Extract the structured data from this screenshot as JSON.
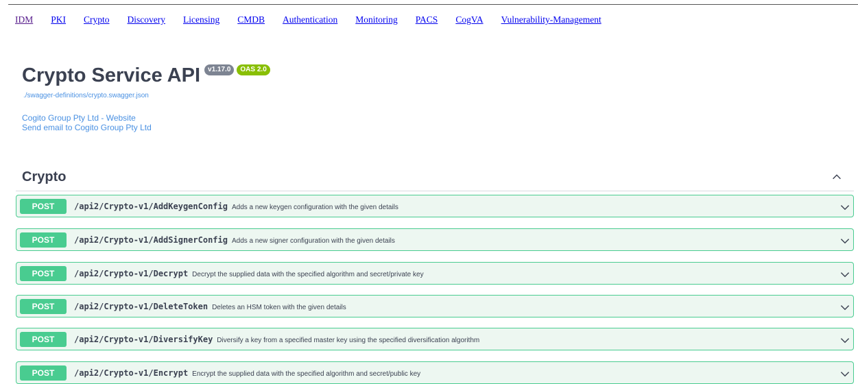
{
  "nav": [
    "IDM",
    "PKI",
    "Crypto",
    "Discovery",
    "Licensing",
    "CMDB",
    "Authentication",
    "Monitoring",
    "PACS",
    "CogVA",
    "Vulnerability-Management"
  ],
  "header": {
    "title": "Crypto Service API",
    "version_badge": "v1.17.0",
    "oas_badge": "OAS 2.0",
    "spec_link": "./swagger-definitions/crypto.swagger.json",
    "website_link": "Cogito Group Pty Ltd - Website",
    "email_link": "Send email to Cogito Group Pty Ltd"
  },
  "section": {
    "title": "Crypto"
  },
  "operations": [
    {
      "method": "POST",
      "path": "/api2/Crypto-v1/AddKeygenConfig",
      "desc": "Adds a new keygen configuration with the given details"
    },
    {
      "method": "POST",
      "path": "/api2/Crypto-v1/AddSignerConfig",
      "desc": "Adds a new signer configuration with the given details"
    },
    {
      "method": "POST",
      "path": "/api2/Crypto-v1/Decrypt",
      "desc": "Decrypt the supplied data with the specified algorithm and secret/private key"
    },
    {
      "method": "POST",
      "path": "/api2/Crypto-v1/DeleteToken",
      "desc": "Deletes an HSM token with the given details"
    },
    {
      "method": "POST",
      "path": "/api2/Crypto-v1/DiversifyKey",
      "desc": "Diversify a key from a specified master key using the specified diversification algorithm"
    },
    {
      "method": "POST",
      "path": "/api2/Crypto-v1/Encrypt",
      "desc": "Encrypt the supplied data with the specified algorithm and secret/public key"
    }
  ],
  "colors": {
    "post": "#49cc90",
    "post_bg": "#edf7f1",
    "link": "#4990e2"
  }
}
